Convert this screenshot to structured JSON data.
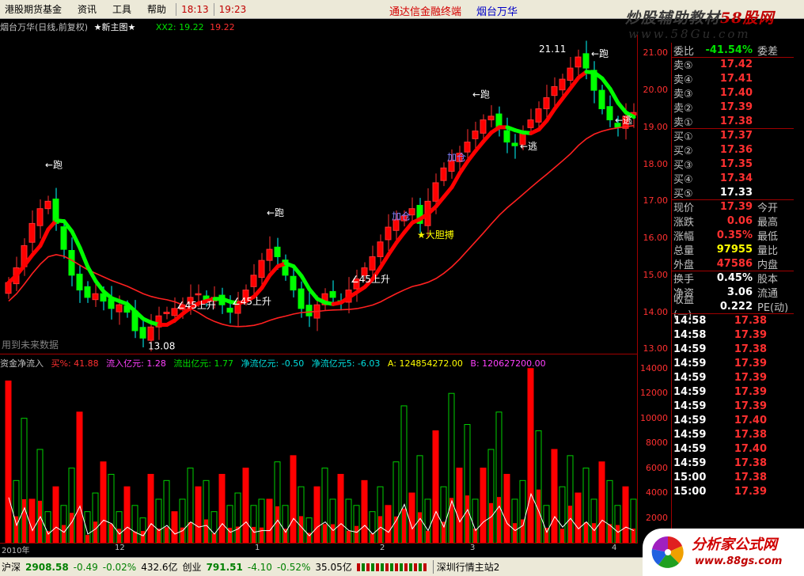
{
  "menu": {
    "items": [
      "港股期货基金",
      "资讯",
      "工具",
      "帮助"
    ],
    "time_a": "18:13",
    "time_b": "19:23",
    "banner": "通达信金融终端",
    "stock_tag": "烟台万华"
  },
  "watermark": {
    "title_a": "炒股辅助教材",
    "title_b": "58股网",
    "url": "www.58Gu.com"
  },
  "chart_header": {
    "title": "烟台万华(日线,前复权)",
    "indicator": "★新主图★",
    "xx2_label": "XX2: 19.22",
    "xx_value": "19.22"
  },
  "main_chart": {
    "annotations": {
      "run": "跑",
      "escape": "逃",
      "add": "加仓",
      "bold": "★大胆搏",
      "rise45": "∠45上升",
      "high": "21.11",
      "low": "13.08",
      "no_future": "用到未来数据"
    }
  },
  "chart_data": [
    {
      "type": "candlestick",
      "title": "烟台万华(日线,前复权)",
      "ylim": [
        12.9,
        21.5
      ],
      "y_ticks": [
        13.0,
        14.0,
        15.0,
        16.0,
        17.0,
        18.0,
        19.0,
        20.0,
        21.0
      ],
      "high_label": 21.11,
      "low_label": 13.08,
      "close_approx": [
        14.8,
        15.2,
        15.8,
        16.4,
        16.8,
        17.0,
        16.4,
        15.7,
        15.0,
        14.6,
        14.4,
        14.5,
        14.3,
        14.1,
        14.2,
        14.0,
        13.5,
        13.3,
        13.6,
        13.9,
        14.0,
        14.1,
        14.2,
        14.4,
        14.5,
        14.3,
        14.4,
        14.2,
        14.0,
        14.3,
        14.6,
        15.0,
        15.4,
        15.7,
        15.5,
        15.0,
        14.6,
        14.1,
        13.9,
        14.2,
        14.5,
        14.4,
        14.3,
        14.6,
        14.9,
        15.2,
        15.5,
        15.9,
        16.3,
        16.5,
        16.6,
        16.8,
        16.4,
        17.0,
        17.5,
        17.9,
        18.1,
        18.3,
        18.6,
        18.9,
        19.2,
        19.3,
        19.0,
        18.6,
        18.5,
        18.9,
        19.2,
        19.5,
        19.8,
        20.1,
        20.3,
        20.6,
        20.9,
        20.6,
        20.0,
        19.5,
        19.2,
        19.0,
        19.3,
        19.4
      ],
      "series": [
        {
          "name": "XX2",
          "last": 19.22
        }
      ]
    },
    {
      "type": "bar",
      "title": "资金净流入",
      "ylim": [
        0,
        15000
      ],
      "y_ticks": [
        2000,
        4000,
        6000,
        8000,
        10000,
        12000,
        14000
      ],
      "values_approx": [
        13000,
        5000,
        10000,
        3500,
        7500,
        2500,
        4500,
        3000,
        6000,
        10500,
        2500,
        4000,
        6500,
        5500,
        2500,
        4500,
        3000,
        2000,
        5500,
        3500,
        5000,
        2500,
        3500,
        6000,
        4500,
        5000,
        2500,
        5500,
        3000,
        4000,
        6000,
        3000,
        3500,
        3500,
        6500,
        3000,
        7000,
        4500,
        2000,
        4500,
        6000,
        3500,
        5500,
        3500,
        3000,
        5000,
        2500,
        4500,
        3000,
        6500,
        11000,
        4000,
        7000,
        3500,
        9000,
        4500,
        12000,
        6000,
        9500,
        3500,
        6000,
        7500,
        10500,
        5500,
        3500,
        5000,
        14000,
        9000,
        3000,
        7500,
        4500,
        7000,
        4000,
        6000,
        3500,
        6500,
        5000,
        3000,
        4500,
        3500
      ]
    }
  ],
  "flow_header": {
    "title": "资金净流入",
    "buy_pct": "买%: 41.88",
    "inflow": "流入亿元: 1.28",
    "outflow": "流出亿元: 1.77",
    "net": "净流亿元: -0.50",
    "net5": "净流亿元5: -6.03",
    "a_val": "A: 124854272.00",
    "b_val": "B: 120627200.00"
  },
  "price_axis": [
    "21.00",
    "20.00",
    "19.00",
    "18.00",
    "17.00",
    "16.00",
    "15.00",
    "14.00",
    "13.00"
  ],
  "vol_axis": [
    "14000",
    "12000",
    "10000",
    "8000",
    "6000",
    "4000",
    "2000"
  ],
  "date_axis": [
    "2010年",
    "12",
    "1",
    "2",
    "3",
    "4"
  ],
  "quote": {
    "weibi_label": "委比",
    "weibi_val": "-41.54%",
    "weicha_label": "委差",
    "sell": [
      {
        "label": "卖⑤",
        "price": "17.42"
      },
      {
        "label": "卖④",
        "price": "17.41"
      },
      {
        "label": "卖③",
        "price": "17.40"
      },
      {
        "label": "卖②",
        "price": "17.39"
      },
      {
        "label": "卖①",
        "price": "17.38"
      }
    ],
    "buy": [
      {
        "label": "买①",
        "price": "17.37"
      },
      {
        "label": "买②",
        "price": "17.36"
      },
      {
        "label": "买③",
        "price": "17.35"
      },
      {
        "label": "买④",
        "price": "17.34"
      },
      {
        "label": "买⑤",
        "price": "17.33"
      }
    ],
    "stats": [
      {
        "label": "现价",
        "val": "17.39",
        "right": "今开",
        "cls": ""
      },
      {
        "label": "涨跌",
        "val": "0.06",
        "right": "最高",
        "cls": ""
      },
      {
        "label": "涨幅",
        "val": "0.35%",
        "right": "最低",
        "cls": ""
      },
      {
        "label": "总量",
        "val": "97955",
        "right": "量比",
        "cls": "yellow"
      },
      {
        "label": "外盘",
        "val": "47586",
        "right": "内盘",
        "cls": ""
      }
    ],
    "stats2": [
      {
        "label": "换手",
        "val": "0.45%",
        "right": "股本"
      },
      {
        "label": "净资",
        "val": "3.06",
        "right": "流通"
      },
      {
        "label": "收益(一)",
        "val": "0.222",
        "right": "PE(动)"
      }
    ],
    "ticks": [
      {
        "time": "14:58",
        "price": "17.38"
      },
      {
        "time": "14:58",
        "price": "17.39"
      },
      {
        "time": "14:59",
        "price": "17.38"
      },
      {
        "time": "14:59",
        "price": "17.39"
      },
      {
        "time": "14:59",
        "price": "17.39"
      },
      {
        "time": "14:59",
        "price": "17.39"
      },
      {
        "time": "14:59",
        "price": "17.39"
      },
      {
        "time": "14:59",
        "price": "17.40"
      },
      {
        "time": "14:59",
        "price": "17.38"
      },
      {
        "time": "14:59",
        "price": "17.40"
      },
      {
        "time": "14:59",
        "price": "17.38"
      },
      {
        "time": "15:00",
        "price": "17.38"
      },
      {
        "time": "15:00",
        "price": "17.39"
      }
    ]
  },
  "logo": {
    "title": "分析家公式网",
    "url": "www.88gs.com"
  },
  "status_bar": {
    "index_name": "沪深",
    "index_val": "2908.58",
    "change": "-0.49",
    "pct": "-0.02%",
    "amount": "432.6亿",
    "index2_name": "创业",
    "index2_val": "791.51",
    "change2": "-4.10",
    "pct2": "-0.52%",
    "amount2": "35.05亿",
    "server": "深圳行情主站2"
  }
}
